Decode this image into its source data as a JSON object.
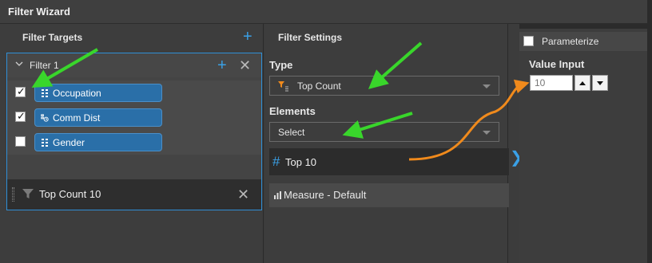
{
  "window": {
    "title": "Filter Wizard"
  },
  "filter_targets": {
    "title": "Filter Targets",
    "filter": {
      "label": "Filter 1",
      "items": [
        {
          "label": "Occupation",
          "checked": true,
          "icon": "dimension-icon"
        },
        {
          "label": "Comm Dist",
          "checked": true,
          "icon": "hierarchy-icon"
        },
        {
          "label": "Gender",
          "checked": false,
          "icon": "dimension-icon"
        }
      ],
      "rule": {
        "label": "Top Count 10",
        "icon": "funnel-icon"
      }
    }
  },
  "filter_settings": {
    "title": "Filter Settings",
    "type_label": "Type",
    "type_value": "Top Count",
    "elements_label": "Elements",
    "elements_value": "Select",
    "top_item": {
      "hash": "#",
      "label": "Top 10"
    },
    "measure_item": {
      "label": "Measure - Default"
    }
  },
  "right_panel": {
    "parameterize_label": "Parameterize",
    "parameterize_checked": false,
    "value_label": "Value Input",
    "value": "10"
  },
  "colors": {
    "accent": "#3aa0e6",
    "pill": "#2a6fa8",
    "arrow_green": "#39d62b",
    "arrow_orange": "#f08a1c"
  }
}
